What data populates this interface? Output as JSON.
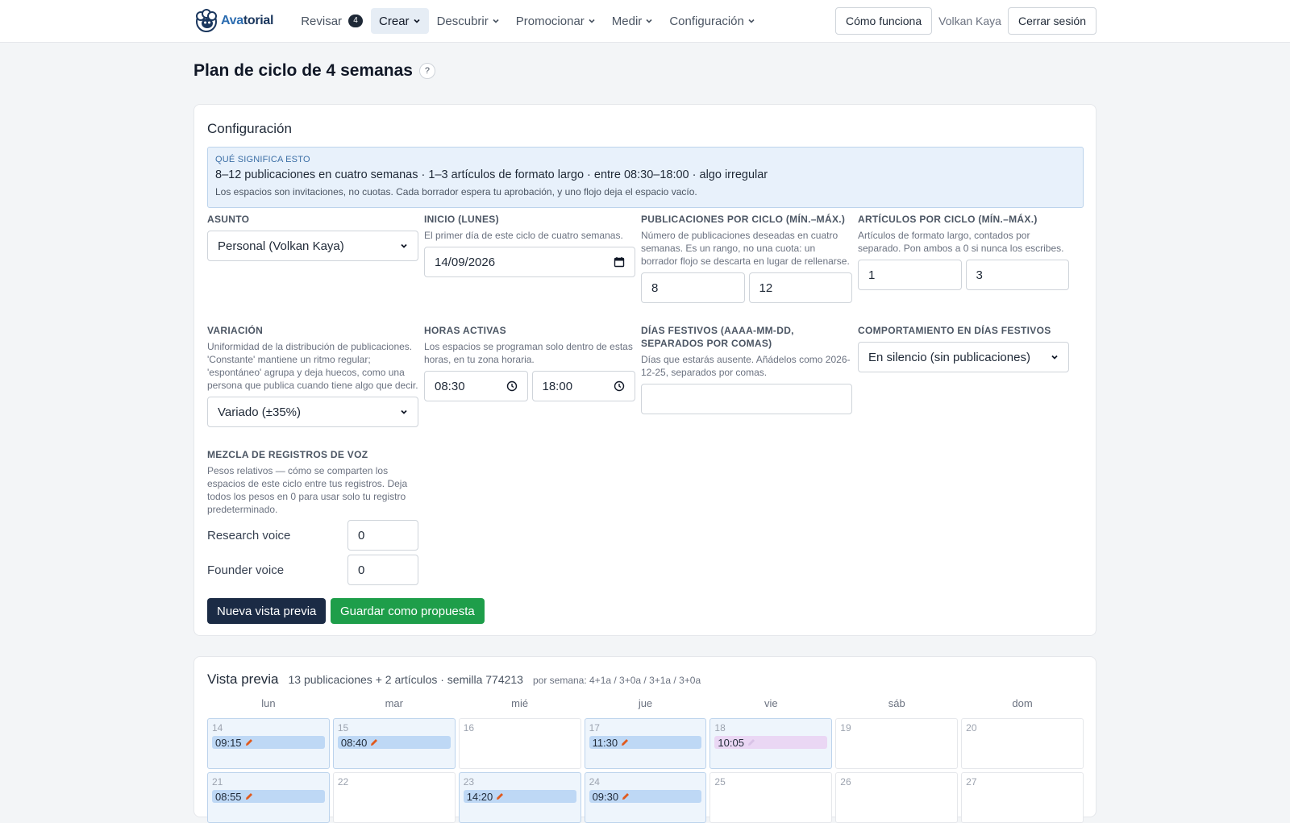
{
  "nav": {
    "logo_text_a": "Ava",
    "logo_text_b": "torial",
    "items": [
      {
        "label": "Revisar",
        "badge": "4"
      },
      {
        "label": "Crear"
      },
      {
        "label": "Descubrir"
      },
      {
        "label": "Promocionar"
      },
      {
        "label": "Medir"
      },
      {
        "label": "Configuración"
      }
    ],
    "how_it_works": "Cómo funciona",
    "user": "Volkan Kaya",
    "logout": "Cerrar sesión",
    "active_item": "Crear"
  },
  "page": {
    "title": "Plan de ciclo de 4 semanas",
    "help": "?"
  },
  "config": {
    "title": "Configuración",
    "info": {
      "kicker": "QUÉ SIGNIFICA ESTO",
      "main": "8–12 publicaciones en cuatro semanas · 1–3 artículos de formato largo · entre 08:30–18:00 · algo irregular",
      "sub": "Los espacios son invitaciones, no cuotas. Cada borrador espera tu aprobación, y uno flojo deja el espacio vacío."
    },
    "subject": {
      "label": "ASUNTO",
      "value": "Personal (Volkan Kaya)"
    },
    "start": {
      "label": "INICIO (LUNES)",
      "hint": "El primer día de este ciclo de cuatro semanas.",
      "value": "14/09/2026"
    },
    "posts": {
      "label": "PUBLICACIONES POR CICLO (MÍN.–MÁX.)",
      "hint": "Número de publicaciones deseadas en cuatro semanas. Es un rango, no una cuota: un borrador flojo se descarta en lugar de rellenarse.",
      "min": "8",
      "max": "12"
    },
    "articles": {
      "label": "ARTÍCULOS POR CICLO (MÍN.–MÁX.)",
      "hint": "Artículos de formato largo, contados por separado. Pon ambos a 0 si nunca los escribes.",
      "min": "1",
      "max": "3"
    },
    "variation": {
      "label": "VARIACIÓN",
      "hint": "Uniformidad de la distribución de publicaciones. 'Constante' mantiene un ritmo regular; 'espontáneo' agrupa y deja huecos, como una persona que publica cuando tiene algo que decir.",
      "value": "Variado (±35%)"
    },
    "hours": {
      "label": "HORAS ACTIVAS",
      "hint": "Los espacios se programan solo dentro de estas horas, en tu zona horaria.",
      "from": "08:30",
      "to": "18:00"
    },
    "holidays": {
      "label": "DÍAS FESTIVOS (AAAA-MM-DD, SEPARADOS POR COMAS)",
      "hint": "Días que estarás ausente. Añádelos como 2026-12-25, separados por comas.",
      "value": ""
    },
    "holiday_behavior": {
      "label": "COMPORTAMIENTO EN DÍAS FESTIVOS",
      "value": "En silencio (sin publicaciones)"
    },
    "voices": {
      "label": "MEZCLA DE REGISTROS DE VOZ",
      "hint": "Pesos relativos — cómo se comparten los espacios de este ciclo entre tus registros. Deja todos los pesos en 0 para usar solo tu registro predeterminado.",
      "items": [
        {
          "name": "Research voice",
          "weight": "0"
        },
        {
          "name": "Founder voice",
          "weight": "0"
        }
      ]
    },
    "btn_preview": "Nueva vista previa",
    "btn_save": "Guardar como propuesta"
  },
  "preview": {
    "title": "Vista previa",
    "summary": "13 publicaciones + 2 artículos · semilla 774213",
    "per_week": "por semana: 4+1a / 3+0a / 3+1a / 3+0a",
    "days_of_week": [
      "lun",
      "mar",
      "mié",
      "jue",
      "vie",
      "sáb",
      "dom"
    ],
    "weeks": [
      [
        {
          "n": "14",
          "slot": "09:15",
          "kind": "post"
        },
        {
          "n": "15",
          "slot": "08:40",
          "kind": "post"
        },
        {
          "n": "16"
        },
        {
          "n": "17",
          "slot": "11:30",
          "kind": "post"
        },
        {
          "n": "18",
          "slot": "10:05",
          "kind": "article"
        },
        {
          "n": "19"
        },
        {
          "n": "20"
        }
      ],
      [
        {
          "n": "21",
          "slot": "08:55",
          "kind": "post"
        },
        {
          "n": "22"
        },
        {
          "n": "23",
          "slot": "14:20",
          "kind": "post"
        },
        {
          "n": "24",
          "slot": "09:30",
          "kind": "post"
        },
        {
          "n": "25"
        },
        {
          "n": "26"
        },
        {
          "n": "27"
        }
      ]
    ],
    "colors": {
      "post": "#bed8f5",
      "article": "#ead7f4",
      "pencil": "#e05a1e"
    }
  }
}
